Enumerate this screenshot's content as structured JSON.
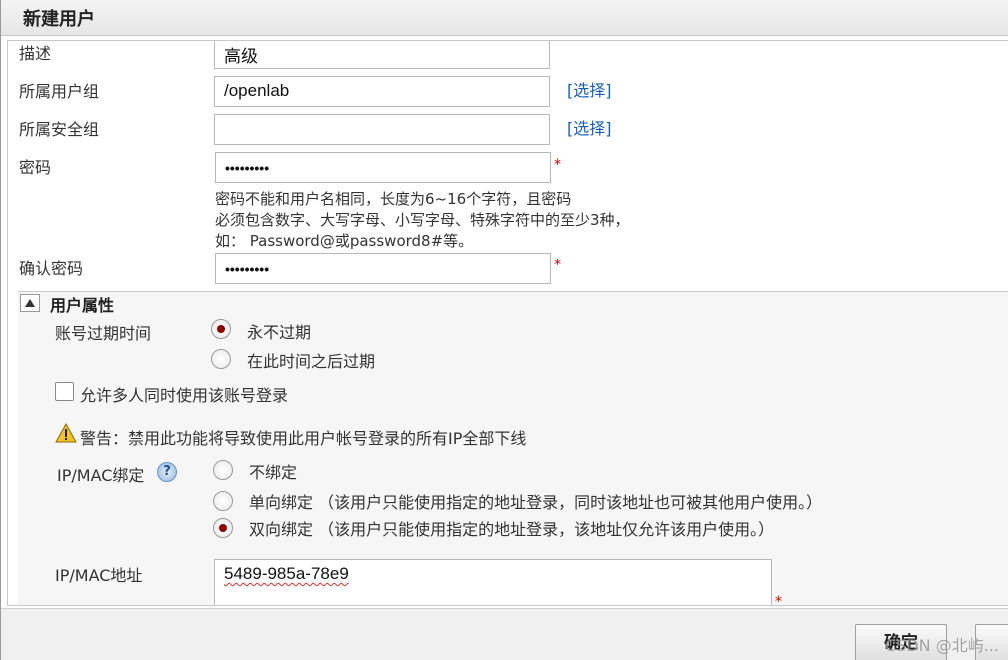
{
  "dialog": {
    "title": "新建用户"
  },
  "form": {
    "description": {
      "label": "描述",
      "value": "高级"
    },
    "user_group": {
      "label": "所属用户组",
      "value": "/openlab",
      "select_link": "[选择]"
    },
    "security_group": {
      "label": "所属安全组",
      "value": "",
      "select_link": "[选择]"
    },
    "password": {
      "label": "密码",
      "value": "•••••••••",
      "required_mark": "*",
      "hint_lines": [
        "密码不能和用户名相同，长度为6~16个字符，且密码",
        "必须包含数字、大写字母、小写字母、特殊字符中的至少3种，",
        "如： Password@或password8#等。"
      ]
    },
    "confirm_password": {
      "label": "确认密码",
      "value": "•••••••••",
      "required_mark": "*"
    }
  },
  "user_properties": {
    "section_title": "用户属性",
    "expiry": {
      "label": "账号过期时间",
      "options": [
        "永不过期",
        "在此时间之后过期"
      ],
      "selected": 0
    },
    "multi_login": {
      "label": "允许多人同时使用该账号登录",
      "checked": false
    },
    "warning": "警告：禁用此功能将导致使用此用户帐号登录的所有IP全部下线",
    "ip_mac_binding": {
      "label": "IP/MAC绑定",
      "help": "?",
      "options": [
        "不绑定",
        "单向绑定 （该用户只能使用指定的地址登录，同时该地址也可被其他用户使用。）",
        "双向绑定 （该用户只能使用指定的地址登录，该地址仅允许该用户使用。）"
      ],
      "selected": 2
    },
    "ip_mac_address": {
      "label": "IP/MAC地址",
      "value": "5489-985a-78e9",
      "required_mark": "*"
    }
  },
  "footer": {
    "ok_button": "确定",
    "watermark": "CSDN @北屿..."
  },
  "icons": {
    "collapse": "triangle-up-icon",
    "warning": "warning-icon",
    "help": "help-icon"
  },
  "colors": {
    "link": "#1a5fb4",
    "required": "#d40000",
    "radio_selected": "#8b0000"
  }
}
